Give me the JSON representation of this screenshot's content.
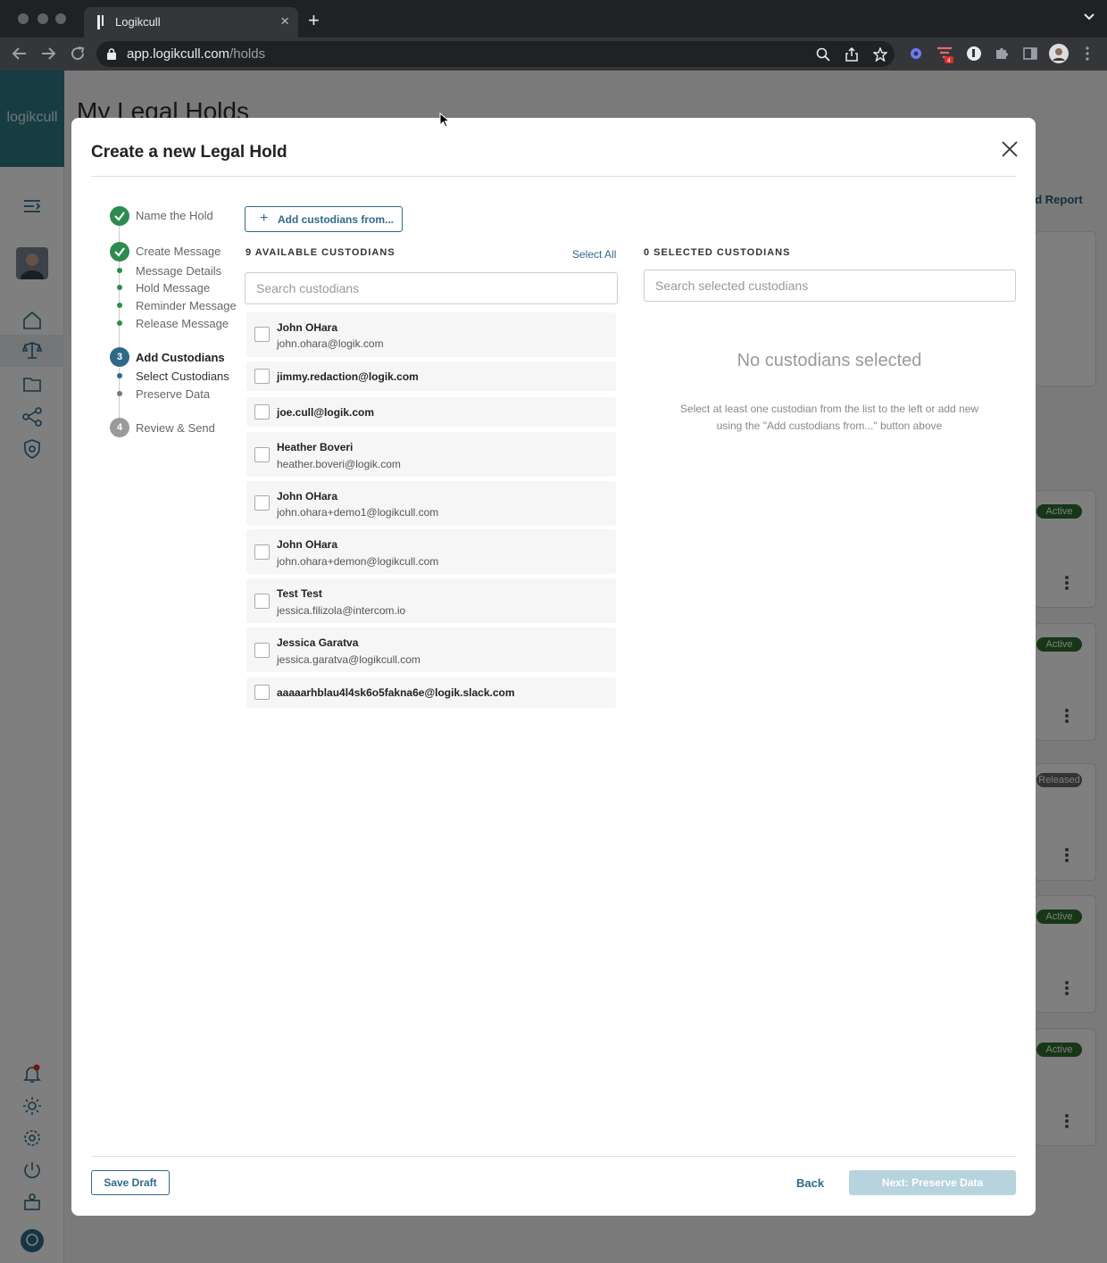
{
  "browser": {
    "tab_title": "Logikcull",
    "url_host": "app.logikcull.com",
    "url_path": "/holds",
    "extension_badge": "4"
  },
  "app": {
    "brand": "logikcull",
    "page_title": "My Legal Holds",
    "report_link": "ad Report",
    "status_badges": [
      "Active",
      "Active",
      "Released",
      "Active",
      "Active"
    ]
  },
  "modal": {
    "title": "Create a new Legal Hold",
    "steps": [
      {
        "label": "Name the Hold",
        "state": "complete"
      },
      {
        "label": "Create Message",
        "state": "complete",
        "substeps": [
          "Message Details",
          "Hold Message",
          "Reminder Message",
          "Release Message"
        ]
      },
      {
        "number": "3",
        "label": "Add Custodians",
        "state": "current",
        "substeps": [
          "Select Custodians",
          "Preserve Data"
        ]
      },
      {
        "number": "4",
        "label": "Review & Send",
        "state": "future"
      }
    ],
    "add_button": "Add custodians from...",
    "available": {
      "heading": "9 AVAILABLE CUSTODIANS",
      "select_all": "Select All",
      "search_placeholder": "Search custodians",
      "items": [
        {
          "name": "John OHara",
          "email": "john.ohara@logik.com"
        },
        {
          "name": "",
          "email": "jimmy.redaction@logik.com"
        },
        {
          "name": "",
          "email": "joe.cull@logik.com"
        },
        {
          "name": "Heather Boveri",
          "email": "heather.boveri@logik.com"
        },
        {
          "name": "John OHara",
          "email": "john.ohara+demo1@logikcull.com"
        },
        {
          "name": "John OHara",
          "email": "john.ohara+demon@logikcull.com"
        },
        {
          "name": "Test Test",
          "email": "jessica.filizola@intercom.io"
        },
        {
          "name": "Jessica Garatva",
          "email": "jessica.garatva@logikcull.com"
        },
        {
          "name": "",
          "email": "aaaaarhblau4l4sk6o5fakna6e@logik.slack.com"
        }
      ]
    },
    "selected": {
      "heading": "0 SELECTED CUSTODIANS",
      "search_placeholder": "Search selected custodians",
      "empty_title": "No custodians selected",
      "empty_description": "Select at least one custodian from the list to the left or add new using the \"Add custodians from...\" button above"
    },
    "footer": {
      "save_draft": "Save Draft",
      "back": "Back",
      "next": "Next: Preserve Data"
    }
  },
  "colors": {
    "accent": "#2e6a88",
    "complete": "#2e8b4e",
    "brand": "#2e7a86",
    "disabled_button": "#b7d3dd"
  }
}
